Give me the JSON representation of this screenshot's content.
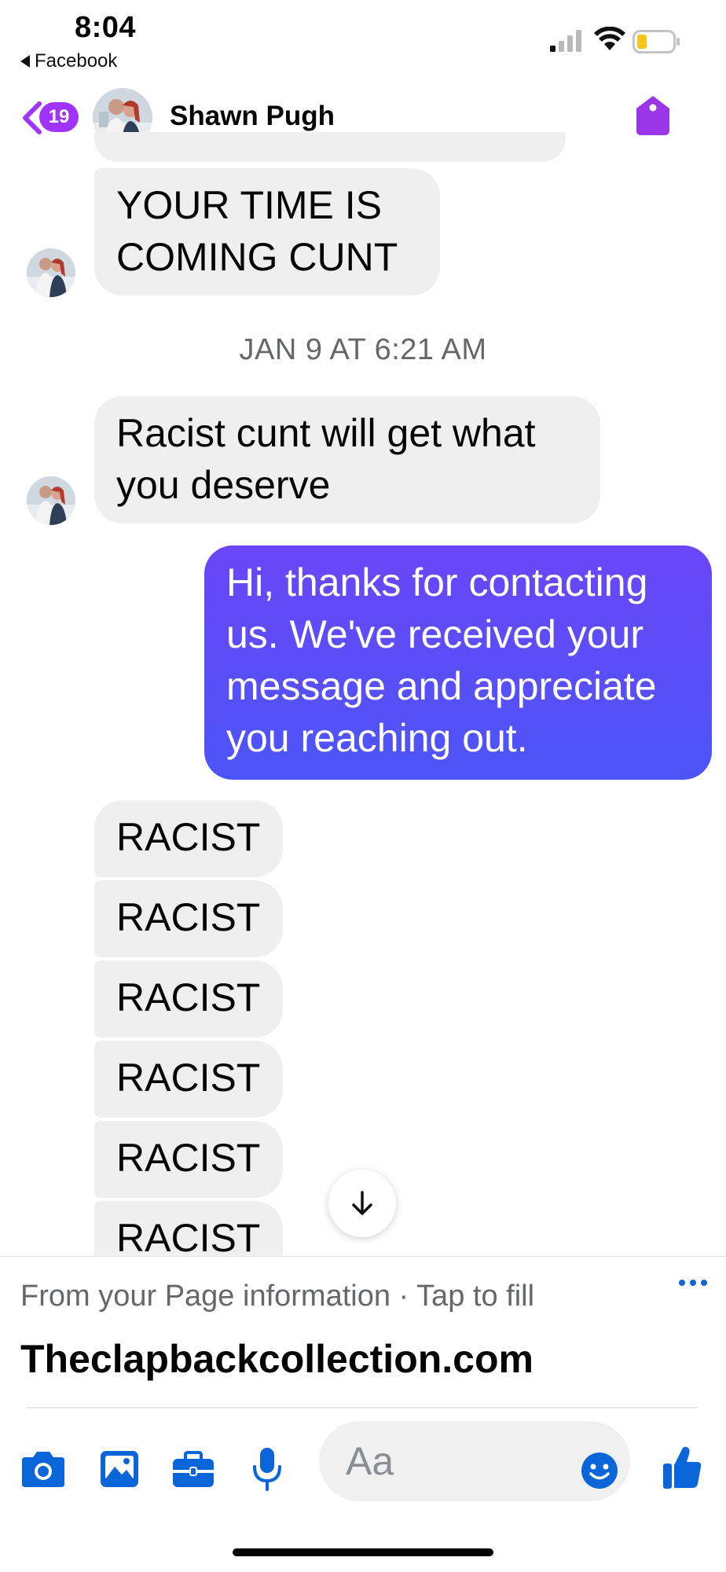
{
  "status_bar": {
    "time": "8:04",
    "back_app_label": "Facebook",
    "battery_color": "#f5c518"
  },
  "header": {
    "unread_count": "19",
    "contact_name": "Shawn Pugh",
    "accent_color": "#a033ff"
  },
  "messages": [
    {
      "sender": "contact",
      "text": "YOUR TIME IS COMING CUNT"
    },
    {
      "type": "timestamp",
      "text": "JAN 9 AT 6:21 AM"
    },
    {
      "sender": "contact",
      "text": "Racist cunt will get what you deserve"
    },
    {
      "sender": "page",
      "text": "Hi, thanks for contacting us. We've received your message and appreciate you reaching out."
    },
    {
      "sender": "contact",
      "text": "RACIST"
    },
    {
      "sender": "contact",
      "text": "RACIST"
    },
    {
      "sender": "contact",
      "text": "RACIST"
    },
    {
      "sender": "contact",
      "text": "RACIST"
    },
    {
      "sender": "contact",
      "text": "RACIST"
    },
    {
      "sender": "contact",
      "text": "RACIST"
    }
  ],
  "autofill": {
    "hint": "From your Page information · Tap to fill",
    "value": "Theclapbackcollection.com"
  },
  "composer": {
    "placeholder": "Aa",
    "icons": [
      "camera-icon",
      "image-icon",
      "briefcase-icon",
      "microphone-icon",
      "emoji-icon",
      "thumbs-up-icon"
    ],
    "icon_color": "#0a66d8"
  },
  "colors": {
    "outgoing_bubble": "#5b4cfa",
    "incoming_bubble": "#efefef"
  }
}
